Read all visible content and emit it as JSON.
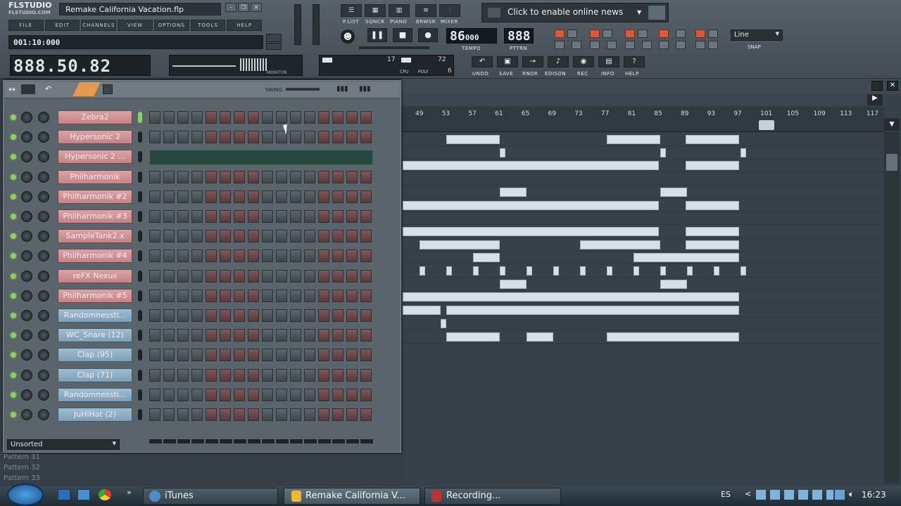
{
  "app": {
    "logo_main": "FLSTUDIO",
    "logo_sub": "FLSTUDIO.COM",
    "title": "Remake California Vacation.flp"
  },
  "menu": [
    "FILE",
    "EDIT",
    "CHANNELS",
    "VIEW",
    "OPTIONS",
    "TOOLS",
    "HELP"
  ],
  "hint": "001:10:000",
  "time_display": "888.50.82",
  "monitor_label": "MONITOR",
  "cpu": {
    "value_a": "17",
    "value_b": "72",
    "cpu_label": "CPU",
    "poly_label": "POLY",
    "poly_value": "6"
  },
  "view_buttons": [
    {
      "icon": "playlist-icon",
      "label": "P.LIST"
    },
    {
      "icon": "song-icon",
      "label": "SQNCR"
    },
    {
      "icon": "piano-icon",
      "label": "PIANO"
    },
    {
      "icon": "browser-icon",
      "label": "BRWSR"
    },
    {
      "icon": "mixer-icon",
      "label": "MIXER"
    }
  ],
  "transport": {
    "tempo_value": "86",
    "tempo_fraction": "000",
    "tempo_label": "TEMPO",
    "pattern_value": "888",
    "pattern_label": "PTTRN"
  },
  "news": "Click to enable online news",
  "snap": {
    "value": "Line",
    "label": "SNAP"
  },
  "actions": [
    "UNDO",
    "SAVE",
    "RNDR",
    "EDISON",
    "REC",
    "INFO",
    "HELP"
  ],
  "seq_toolbar": {
    "swing_label": "SWING"
  },
  "channels": [
    {
      "name": "Zebra2",
      "color": "red",
      "mode": "steps"
    },
    {
      "name": "Hypersonic 2",
      "color": "red",
      "mode": "steps"
    },
    {
      "name": "Hypersonic 2 ...",
      "color": "red",
      "mode": "piano"
    },
    {
      "name": "Philharmonik",
      "color": "red",
      "mode": "steps"
    },
    {
      "name": "Philharmonik #2",
      "color": "red",
      "mode": "steps"
    },
    {
      "name": "Philharmonik #3",
      "color": "red",
      "mode": "steps"
    },
    {
      "name": "SampleTank2.x",
      "color": "red",
      "mode": "steps"
    },
    {
      "name": "Philharmonik #4",
      "color": "red",
      "mode": "steps"
    },
    {
      "name": "reFX Nexus",
      "color": "red",
      "mode": "steps"
    },
    {
      "name": "Philharmonik #5",
      "color": "red",
      "mode": "steps"
    },
    {
      "name": "Randomnessti...",
      "color": "blue",
      "mode": "steps"
    },
    {
      "name": "WC_Snare (12)",
      "color": "blue",
      "mode": "steps"
    },
    {
      "name": "Clap (95)",
      "color": "blue",
      "mode": "steps"
    },
    {
      "name": "Clap (71)",
      "color": "blue",
      "mode": "steps"
    },
    {
      "name": "Randomnessti...",
      "color": "blue",
      "mode": "steps"
    },
    {
      "name": "JuHiHat (2)",
      "color": "blue",
      "mode": "steps"
    }
  ],
  "unsorted_label": "Unsorted",
  "timeline_ticks": [
    "49",
    "53",
    "57",
    "61",
    "65",
    "69",
    "73",
    "77",
    "81",
    "85",
    "89",
    "93",
    "97",
    "101",
    "105",
    "109",
    "113",
    "117"
  ],
  "patterns": [
    "Pattern 31",
    "Pattern 32",
    "Pattern 33"
  ],
  "taskbar": {
    "items": [
      "iTunes",
      "Remake California V...",
      "Recording..."
    ],
    "lang": "ES",
    "time": "16:23"
  }
}
